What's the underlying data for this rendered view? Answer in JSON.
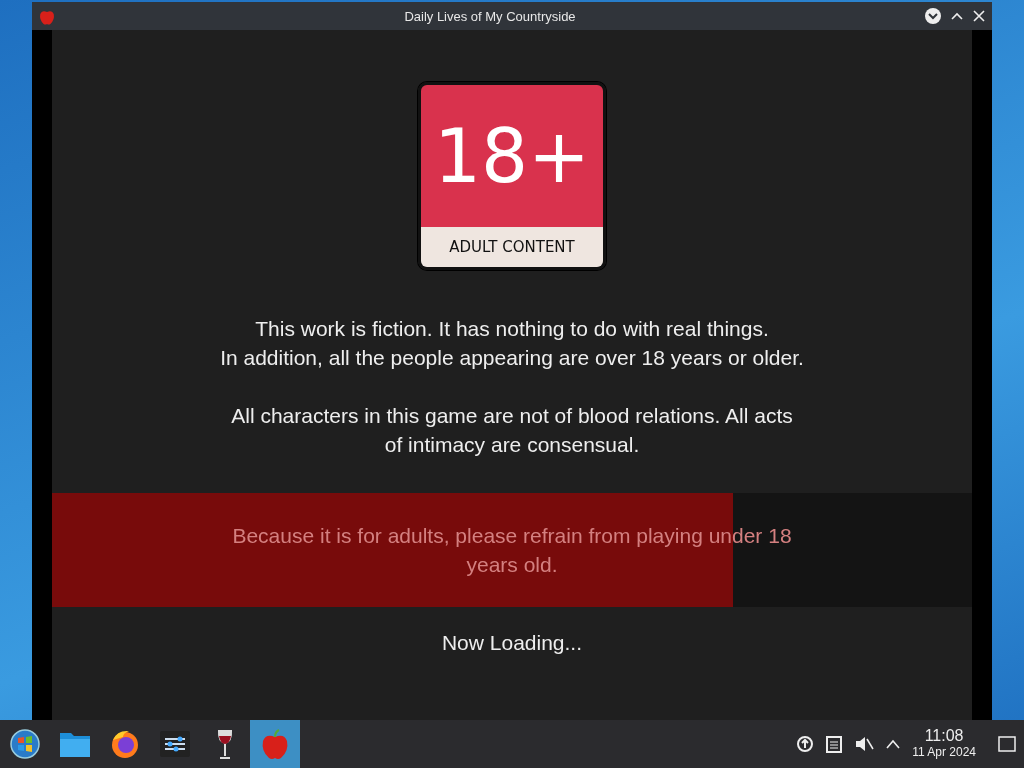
{
  "window": {
    "title": "Daily Lives of My Countryside"
  },
  "badge": {
    "number": "18+",
    "label": "ADULT CONTENT"
  },
  "paragraphs": [
    {
      "lines": [
        "This work is fiction. It has nothing to do with real things.",
        "In addition, all the people appearing are over 18 years or older."
      ]
    },
    {
      "lines": [
        "All characters in this game are not of blood relations. All acts",
        "of intimacy are consensual."
      ]
    }
  ],
  "warning": {
    "lines": [
      "Because it is for adults, please refrain from playing under 18",
      "years old."
    ],
    "level": 0.74
  },
  "loading": "Now Loading...",
  "taskbar": {
    "apps": [
      {
        "kind": "start",
        "selected": false
      },
      {
        "kind": "folder",
        "selected": false
      },
      {
        "kind": "browser",
        "selected": false
      },
      {
        "kind": "sliders",
        "selected": false
      },
      {
        "kind": "wine",
        "selected": false
      },
      {
        "kind": "apple",
        "selected": true
      }
    ],
    "clock": {
      "time": "11:08",
      "date": "11 Apr 2024"
    }
  }
}
